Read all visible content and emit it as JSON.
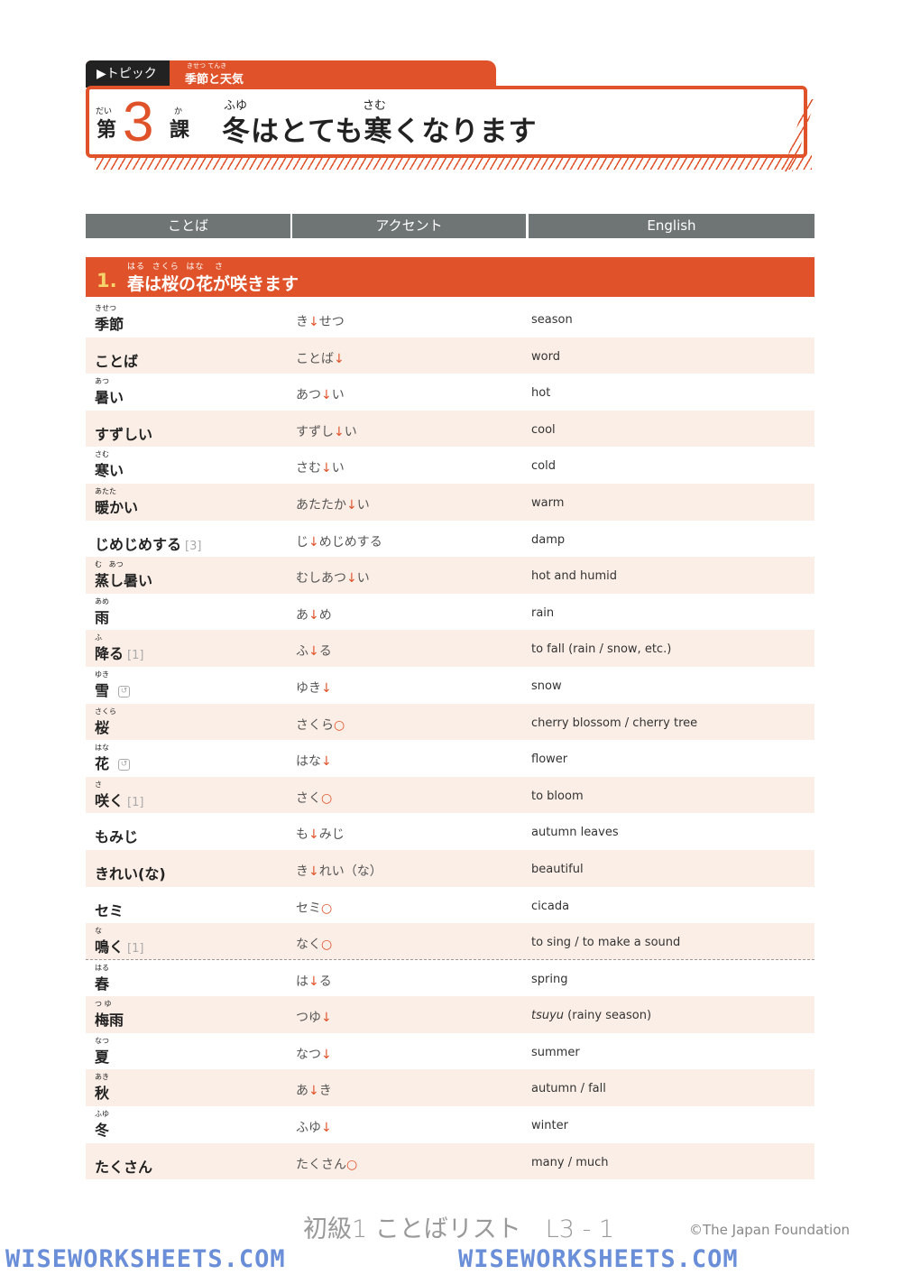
{
  "header": {
    "topic_label": "▶トピック",
    "theme": "季節と天気",
    "theme_furigana": "きせつ  てんき",
    "dai": "第",
    "dai_furigana": "だい",
    "lesson_number": "3",
    "ka": "課",
    "ka_furigana": "か",
    "lesson_title": "冬はとても寒くなります",
    "title_furigana_1": "ふゆ",
    "title_furigana_2": "さむ"
  },
  "columns": [
    "ことば",
    "アクセント",
    "English"
  ],
  "section": {
    "number": "1.",
    "title": "春は桜の花が咲きます",
    "furigana": "はる  さくら  はな   さ"
  },
  "rows": [
    {
      "f": "きせつ",
      "w": "季節",
      "n": "",
      "a": "き↓せつ",
      "e": "season"
    },
    {
      "f": "",
      "w": "ことば",
      "n": "",
      "a": "ことば↓",
      "e": "word"
    },
    {
      "f": "あつ",
      "w": "暑い",
      "n": "",
      "a": "あつ↓い",
      "e": "hot"
    },
    {
      "f": "",
      "w": "すずしい",
      "n": "",
      "a": "すずし↓い",
      "e": "cool"
    },
    {
      "f": "さむ",
      "w": "寒い",
      "n": "",
      "a": "さむ↓い",
      "e": "cold"
    },
    {
      "f": "あたた",
      "w": "暖かい",
      "n": "",
      "a": "あたたか↓い",
      "e": "warm"
    },
    {
      "f": "",
      "w": "じめじめする",
      "n": "[3]",
      "a": "じ↓めじめする",
      "e": "damp"
    },
    {
      "f": "む   あつ",
      "w": "蒸し暑い",
      "n": "",
      "a": "むしあつ↓い",
      "e": "hot and humid"
    },
    {
      "f": "あめ",
      "w": "雨",
      "n": "",
      "a": "あ↓め",
      "e": "rain"
    },
    {
      "f": "ふ",
      "w": "降る",
      "n": "[1]",
      "a": "ふ↓る",
      "e": "to fall (rain / snow, etc.)"
    },
    {
      "f": "ゆき",
      "w": "雪",
      "n": "",
      "icon": "countable-icon",
      "a": "ゆき↓",
      "e": "snow"
    },
    {
      "f": "さくら",
      "w": "桜",
      "n": "",
      "a": "さくら○",
      "e": "cherry blossom / cherry tree"
    },
    {
      "f": "はな",
      "w": "花",
      "n": "",
      "icon": "countable-icon",
      "a": "はな↓",
      "e": "flower"
    },
    {
      "f": "さ",
      "w": "咲く",
      "n": "[1]",
      "a": "さく○",
      "e": "to bloom"
    },
    {
      "f": "",
      "w": "もみじ",
      "n": "",
      "a": "も↓みじ",
      "e": "autumn leaves"
    },
    {
      "f": "",
      "w": "きれい(な)",
      "n": "",
      "a": "き↓れい（な）",
      "e": "beautiful"
    },
    {
      "f": "",
      "w": "セミ",
      "n": "",
      "a": "セミ○",
      "e": "cicada"
    },
    {
      "f": "な",
      "w": "鳴く",
      "n": "[1]",
      "a": "なく○",
      "e": "to sing / to make a sound"
    },
    {
      "f": "はる",
      "w": "春",
      "n": "",
      "a": "は↓る",
      "e": "spring"
    },
    {
      "f": "つ ゆ",
      "w": "梅雨",
      "n": "",
      "a": "つゆ↓",
      "e": "tsuyu (rainy season)"
    },
    {
      "f": "なつ",
      "w": "夏",
      "n": "",
      "a": "なつ↓",
      "e": "summer"
    },
    {
      "f": "あき",
      "w": "秋",
      "n": "",
      "a": "あ↓き",
      "e": "autumn / fall"
    },
    {
      "f": "ふゆ",
      "w": "冬",
      "n": "",
      "a": "ふゆ↓",
      "e": "winter"
    },
    {
      "f": "",
      "w": "たくさん",
      "n": "",
      "a": "たくさん○",
      "e": "many / much"
    }
  ],
  "footer": {
    "page_label": "初級1 ことばリスト　L3 - 1",
    "copyright": "©The Japan Foundation",
    "watermark": "WISEWORKSHEETS.COM"
  },
  "colors": {
    "accent": "#e0532a",
    "header_gray": "#6f7475",
    "row_band": "#fbeee6"
  }
}
